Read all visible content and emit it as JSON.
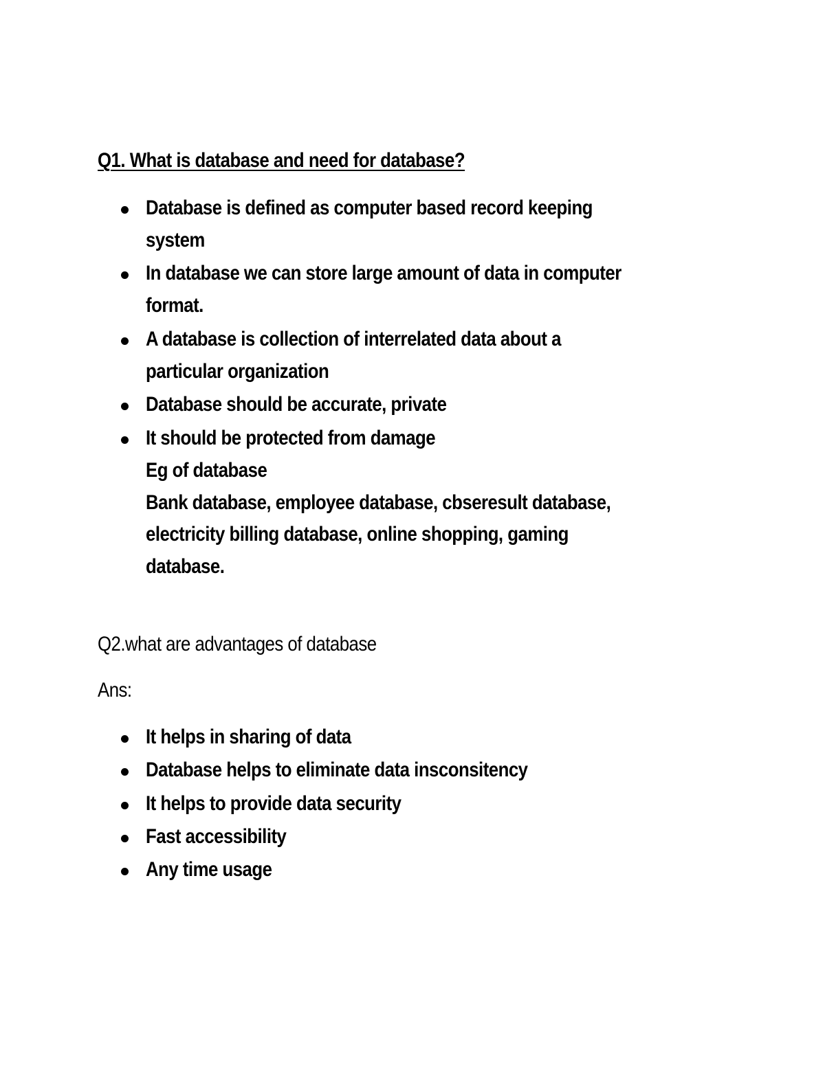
{
  "q1": {
    "title": "Q1. What is database and need for database?",
    "bullets": [
      [
        "Database is defined as computer based record keeping",
        "system"
      ],
      [
        "In database we can store large amount of data in computer",
        "format."
      ],
      [
        "A database is collection of interrelated data about a",
        "particular organization"
      ],
      [
        "Database should be accurate, private"
      ],
      [
        "It should be protected from damage",
        "Eg of database",
        "Bank database, employee database, cbseresult database,",
        "electricity billing database, online shopping, gaming",
        "database."
      ]
    ]
  },
  "q2": {
    "title": "Q2.what are advantages of database",
    "ans_label": "Ans:",
    "bullets": [
      "It helps in sharing of data",
      "Database helps to eliminate data insconsitency",
      "It helps to provide data security",
      "Fast accessibility",
      "Any time usage"
    ]
  }
}
